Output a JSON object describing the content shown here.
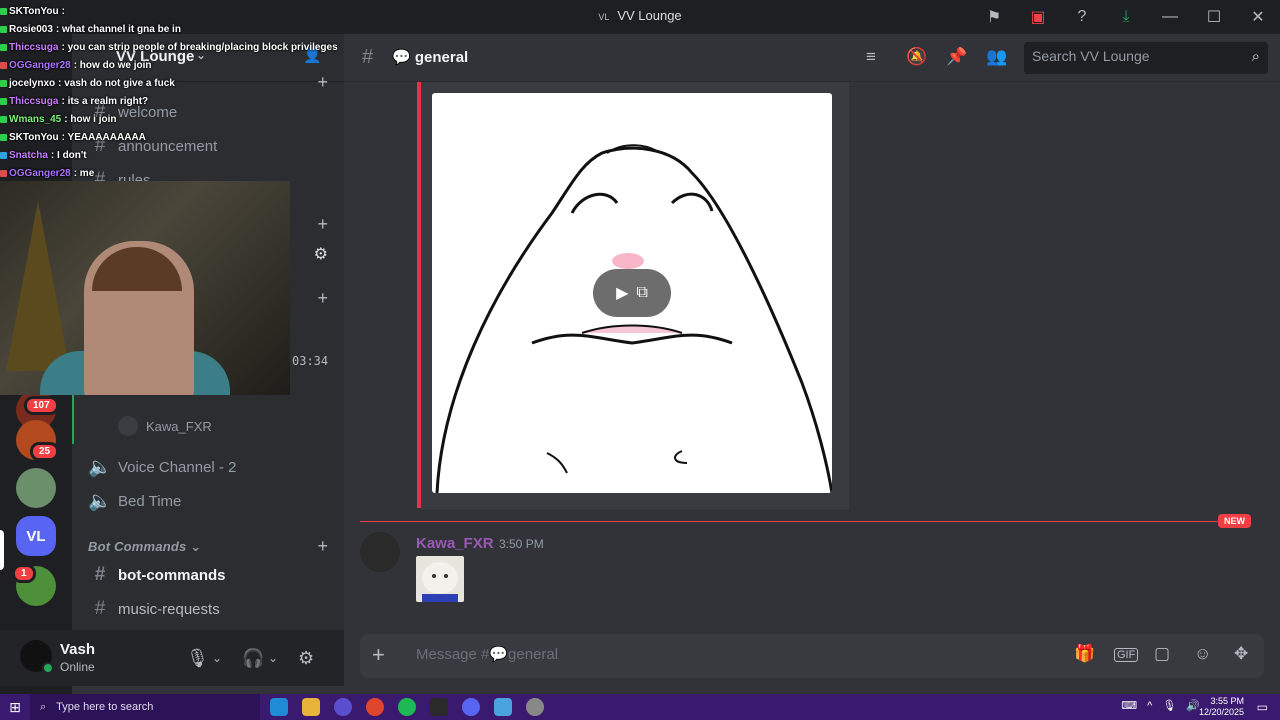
{
  "window": {
    "title": "VV Lounge",
    "title_prefix": "VL"
  },
  "titlebar_icons": [
    "flag-icon",
    "screen-icon",
    "help-icon",
    "download-icon",
    "minimize-icon",
    "maximize-icon",
    "close-icon"
  ],
  "server": {
    "name": "VV Lounge",
    "active_initials": "VL",
    "badges": {
      "b1": "107",
      "b2": "25",
      "b3": "1"
    }
  },
  "sidebar": {
    "channels_top": [
      {
        "label": "welcome"
      },
      {
        "label": "announcement"
      },
      {
        "label": "rules"
      }
    ],
    "voice_users": [
      "Kawa_FXR"
    ],
    "voice_channels": [
      {
        "label": "Voice Channel - 2"
      },
      {
        "label": "Bed Time"
      }
    ],
    "category": "Bot Commands",
    "bot_channels": [
      {
        "label": "bot-commands"
      },
      {
        "label": "music-requests"
      }
    ],
    "timer": "03:34"
  },
  "user": {
    "name": "Vash",
    "status": "Online"
  },
  "header": {
    "channel": "general",
    "search_placeholder": "Search VV Lounge"
  },
  "messages": {
    "new_label": "NEW",
    "author": "Kawa_FXR",
    "time": "3:50 PM"
  },
  "composer": {
    "placeholder": "Message #💬general"
  },
  "taskbar": {
    "search_placeholder": "Type here to search",
    "time": "3:55 PM",
    "date": "12/20/2025"
  },
  "overlay_chat": [
    {
      "name": "SKTonYou",
      "text": ":",
      "color": "#ffffff"
    },
    {
      "name": "Rosie003",
      "text": ": what channel it gna be in",
      "color": "#ffffff"
    },
    {
      "name": "Thiccsuga",
      "text": ": you can strip people of breaking/placing block privileges",
      "color": "#c77dff"
    },
    {
      "name": "OGGanger28",
      "text": ": how do we join",
      "color": "#a970ff"
    },
    {
      "name": "jocelynxo",
      "text": ": vash do not give a fuck",
      "color": "#ffffff"
    },
    {
      "name": "Thiccsuga",
      "text": ": its a realm right?",
      "color": "#c77dff"
    },
    {
      "name": "Wmans_45",
      "text": ": how i join",
      "color": "#7cf27c"
    },
    {
      "name": "SKTonYou",
      "text": ": YEAAAAAAAAA",
      "color": "#ffffff"
    },
    {
      "name": "Snatcha",
      "text": ": I don't",
      "color": "#c77dff"
    },
    {
      "name": "OGGanger28",
      "text": ": me",
      "color": "#a970ff"
    }
  ],
  "colors": {
    "mention": "#e8314b",
    "online": "#23a55a",
    "accent": "#5865f2"
  }
}
